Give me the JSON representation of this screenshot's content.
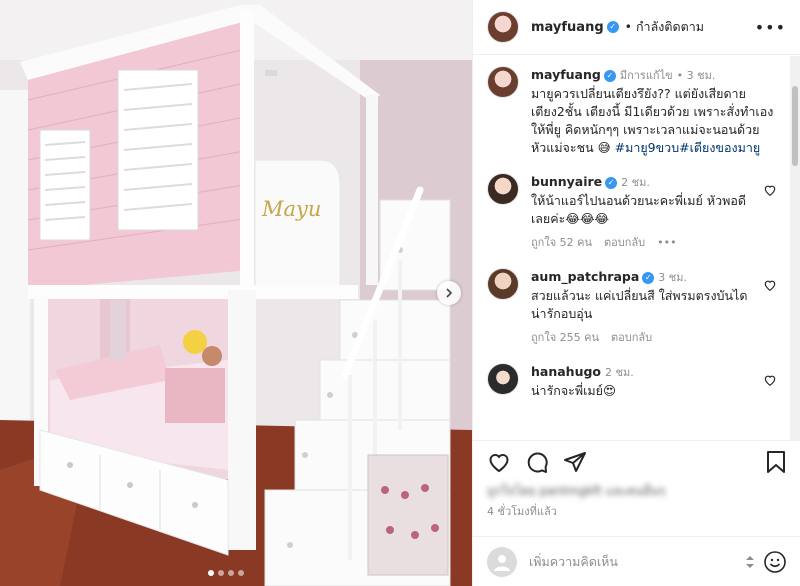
{
  "header": {
    "username": "mayfuang",
    "follow_state": "• กำลังติดตาม",
    "more": "•••"
  },
  "caption": {
    "username": "mayfuang",
    "edited": "มีการแก้ไข",
    "time": "• 3 ชม.",
    "text": "มายูควรเปลี่ยนเตียงรึยัง?? แต่ยังเสียดายเตียง2ชั้น เตียงนี้ มี1เดียวด้วย เพราะสั่งทำเองให้พี่ยู คิดหนักๆๆ เพราะเวลาแม่จะนอนด้วย หัวแม่จะชน 😅",
    "hashtags": "#มายู9ขวบ#เตียงของมายู"
  },
  "comments": [
    {
      "username": "bunnyaire",
      "time": "2 ชม.",
      "text": "ให้น้าแอร์ไปนอนด้วยนะคะพี่เมย์ หัวพอดีเลยค่ะ😂😂😂",
      "likes": "ถูกใจ 52 คน",
      "reply": "ตอบกลับ",
      "more": "•••"
    },
    {
      "username": "aum_patchrapa",
      "time": "3 ชม.",
      "text": "สวยแล้วนะ แค่เปลี่ยนสี ใส่พรมตรงบันได น่ารักอบอุ่น",
      "likes": "ถูกใจ 255 คน",
      "reply": "ตอบกลับ"
    },
    {
      "username": "hanahugo",
      "time": "2 ชม.",
      "text": "น่ารักจะพี่เมย์😍",
      "likes": "",
      "reply": ""
    }
  ],
  "photo": {
    "name_plate": "Mayu"
  },
  "likes_summary": "ถูกใจโดย pantmgkft และคนอื่นๆ",
  "time_ago": "4 ชั่วโมงที่แล้ว",
  "add_comment": {
    "placeholder": "เพิ่มความคิดเห็น"
  }
}
